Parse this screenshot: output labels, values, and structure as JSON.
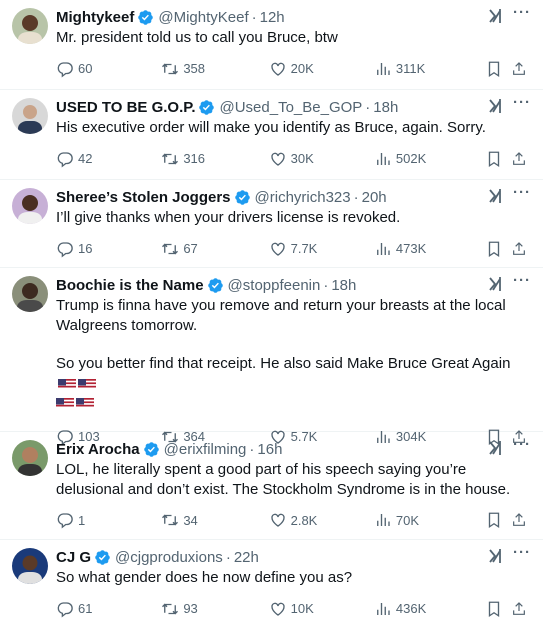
{
  "tweets": [
    {
      "name": "Mightykeef",
      "verified": true,
      "handle": "@MightyKeef",
      "time": "12h",
      "paragraphs": [
        "Mr. president told us to call you Bruce, btw"
      ],
      "replies": "60",
      "retweets": "358",
      "likes": "20K",
      "views": "311K"
    },
    {
      "name": "USED TO BE G.O.P.",
      "verified": true,
      "handle": "@Used_To_Be_GOP",
      "time": "18h",
      "paragraphs": [
        "His executive order will make you identify as Bruce, again. Sorry."
      ],
      "replies": "42",
      "retweets": "316",
      "likes": "30K",
      "views": "502K"
    },
    {
      "name": "Sheree’s Stolen Joggers",
      "verified": true,
      "handle": "@richyrich323",
      "time": "20h",
      "paragraphs": [
        "I’ll give thanks when your drivers license is revoked."
      ],
      "replies": "16",
      "retweets": "67",
      "likes": "7.7K",
      "views": "473K"
    },
    {
      "name": "Boochie is the Name",
      "verified": true,
      "handle": "@stoppfeenin",
      "time": "18h",
      "paragraphs": [
        "Trump is finna have you remove and return your breasts at the local Walgreens tomorrow.",
        "So you better find that receipt. He also said Make Bruce Great Again"
      ],
      "flags": 4,
      "replies": "103",
      "retweets": "364",
      "likes": "5.7K",
      "views": "304K"
    },
    {
      "name": "Erix Arocha",
      "verified": true,
      "handle": "@erixfilming",
      "time": "16h",
      "paragraphs": [
        "LOL, he literally spent a good part of his speech saying you’re delusional and don’t exist. The Stockholm Syndrome is in the house."
      ],
      "replies": "1",
      "retweets": "34",
      "likes": "2.8K",
      "views": "70K"
    },
    {
      "name": "CJ G",
      "verified": true,
      "handle": "@cjgproduxions",
      "time": "22h",
      "paragraphs": [
        "So what gender does he now define you as?"
      ],
      "replies": "61",
      "retweets": "93",
      "likes": "10K",
      "views": "436K"
    }
  ],
  "ui": {
    "separator": "·",
    "more": "···"
  },
  "colors": {
    "verified": "#1d9bf0",
    "muted": "#536471",
    "text": "#0f1419",
    "divider": "#eff3f4"
  },
  "icons": [
    "verified-badge-icon",
    "grok-icon",
    "more-icon",
    "reply-icon",
    "retweet-icon",
    "like-icon",
    "views-icon",
    "bookmark-icon",
    "share-icon",
    "us-flag-icon"
  ]
}
